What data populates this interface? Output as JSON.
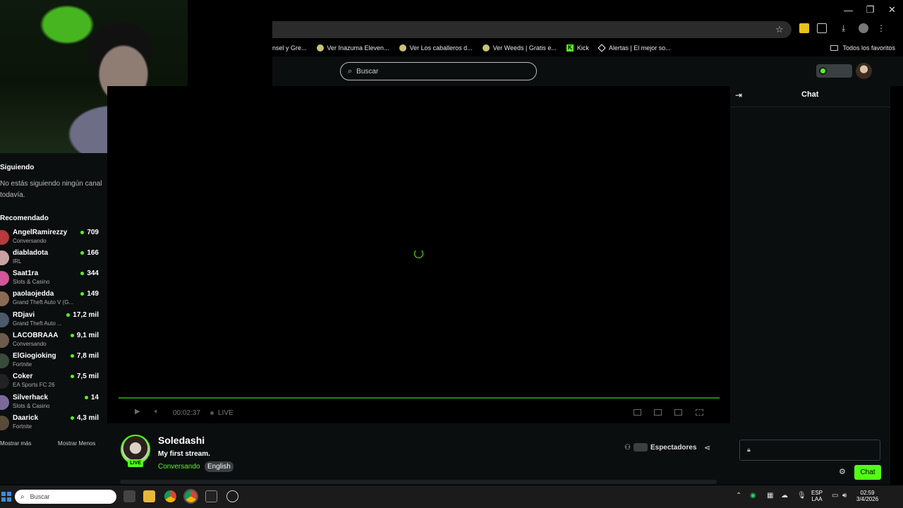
{
  "window": {
    "minimize": "—",
    "maximize": "❐",
    "close": "✕"
  },
  "browser": {
    "bookmarks": [
      {
        "label": "nsel y Gre...",
        "icon": "none"
      },
      {
        "label": "Ver Inazuma Eleven...",
        "icon": "site-icon"
      },
      {
        "label": "Ver Los caballeros d...",
        "icon": "site-icon"
      },
      {
        "label": "Ver Weeds | Gratis e...",
        "icon": "site-icon"
      },
      {
        "label": "Kick",
        "icon": "kick-icon"
      },
      {
        "label": "Alertas | El mejor so...",
        "icon": "alert-icon"
      }
    ],
    "all_favorites": "Todos los favoritos"
  },
  "site": {
    "search_placeholder": "Buscar",
    "accent": "#53fc18"
  },
  "sidebar": {
    "following_title": "Siguiendo",
    "following_empty": "No estás siguiendo ningún canal todavía.",
    "recommended_title": "Recomendado",
    "channels": [
      {
        "name": "AngelRamirezzy",
        "category": "Conversando",
        "viewers": "709"
      },
      {
        "name": "diabladota",
        "category": "IRL",
        "viewers": "166"
      },
      {
        "name": "Saat1ra",
        "category": "Slots & Casino",
        "viewers": "344"
      },
      {
        "name": "paolaojedda",
        "category": "Grand Theft Auto V (G...",
        "viewers": "149"
      },
      {
        "name": "RDjavi",
        "category": "Grand Theft Auto ...",
        "viewers": "17,2 mil"
      },
      {
        "name": "LACOBRAAA",
        "category": "Conversando",
        "viewers": "9,1 mil"
      },
      {
        "name": "ElGiogioking",
        "category": "Fortnite",
        "viewers": "7,8 mil"
      },
      {
        "name": "Coker",
        "category": "EA Sports FC 26",
        "viewers": "7,5 mil"
      },
      {
        "name": "Silverhack",
        "category": "Slots & Casino",
        "viewers": "14"
      },
      {
        "name": "Daarick",
        "category": "Fortnite",
        "viewers": "4,3 mil"
      }
    ],
    "show_more": "Mostrar más",
    "show_less": "Mostrar Menos"
  },
  "player": {
    "elapsed": "00:02:37",
    "live_label": "LIVE",
    "play_icon": "play-icon",
    "volume_icon": "volume-icon"
  },
  "stream": {
    "streamer": "Soledashi",
    "title": "My first stream.",
    "category": "Conversando",
    "language": "English",
    "live_badge": "LIVE",
    "viewers_label": "Espectadores"
  },
  "chat": {
    "title": "Chat",
    "send_label": "Chat"
  },
  "taskbar": {
    "search_placeholder": "Buscar",
    "lang_top": "ESP",
    "lang_bottom": "LAA",
    "time": "02:59",
    "date": "3/4/2026"
  }
}
